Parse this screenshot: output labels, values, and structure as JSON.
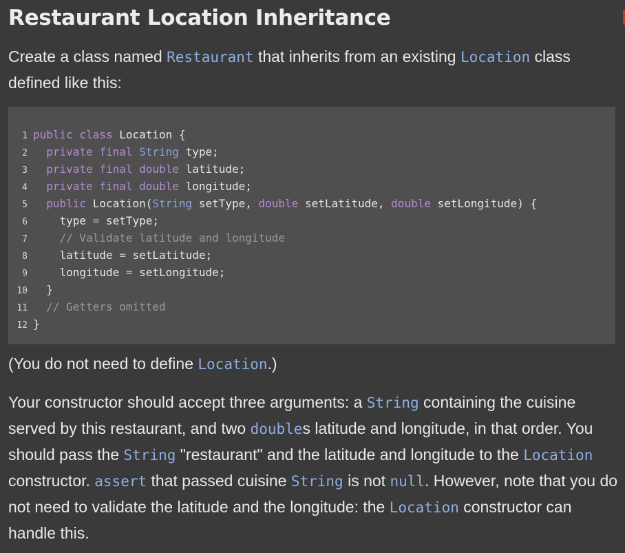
{
  "title": "Restaurant Location Inheritance",
  "intro": {
    "t1": "Create a class named ",
    "c1": "Restaurant",
    "t2": " that inherits from an existing ",
    "c2": "Location",
    "t3": " class defined like this:"
  },
  "code": {
    "line_numbers": [
      "1",
      "2",
      "3",
      "4",
      "5",
      "6",
      "7",
      "8",
      "9",
      "10",
      "11",
      "12"
    ],
    "l1": [
      "public class",
      " Location {"
    ],
    "l2": [
      "  ",
      "private final",
      " ",
      "String",
      " type;"
    ],
    "l3": [
      "  ",
      "private final",
      " ",
      "double",
      " latitude;"
    ],
    "l4": [
      "  ",
      "private final",
      " ",
      "double",
      " longitude;"
    ],
    "l5": [
      "  ",
      "public",
      " Location(",
      "String",
      " setType, ",
      "double",
      " setLatitude, ",
      "double",
      " setLongitude) {"
    ],
    "l6": [
      "    type ",
      "=",
      " setType;"
    ],
    "l7": [
      "    ",
      "// Validate latitude and longitude"
    ],
    "l8": [
      "    latitude ",
      "=",
      " setLatitude;"
    ],
    "l9": [
      "    longitude ",
      "=",
      " setLongitude;"
    ],
    "l10": [
      "  }"
    ],
    "l11": [
      "  ",
      "// Getters omitted"
    ],
    "l12": [
      "}"
    ]
  },
  "note": {
    "t1": "(You do not need to define ",
    "c1": "Location",
    "t2": ".)"
  },
  "instructions": {
    "t1": "Your constructor should accept three arguments: a ",
    "c1": "String",
    "t2": " containing the cuisine served by this restaurant, and two ",
    "c2": "double",
    "t3": "s latitude and longitude, in that order. You should pass the ",
    "c3": "String",
    "t4": " \"restaurant\" and the latitude and longitude to the ",
    "c4": "Location",
    "t5": " constructor. ",
    "c5": "assert",
    "t6": " that passed cuisine ",
    "c6": "String",
    "t7": " is not ",
    "c7": "null",
    "t8": ". However, note that you do not need to validate the latitude and the longitude: the ",
    "c8": "Location",
    "t9": " constructor can handle this."
  }
}
